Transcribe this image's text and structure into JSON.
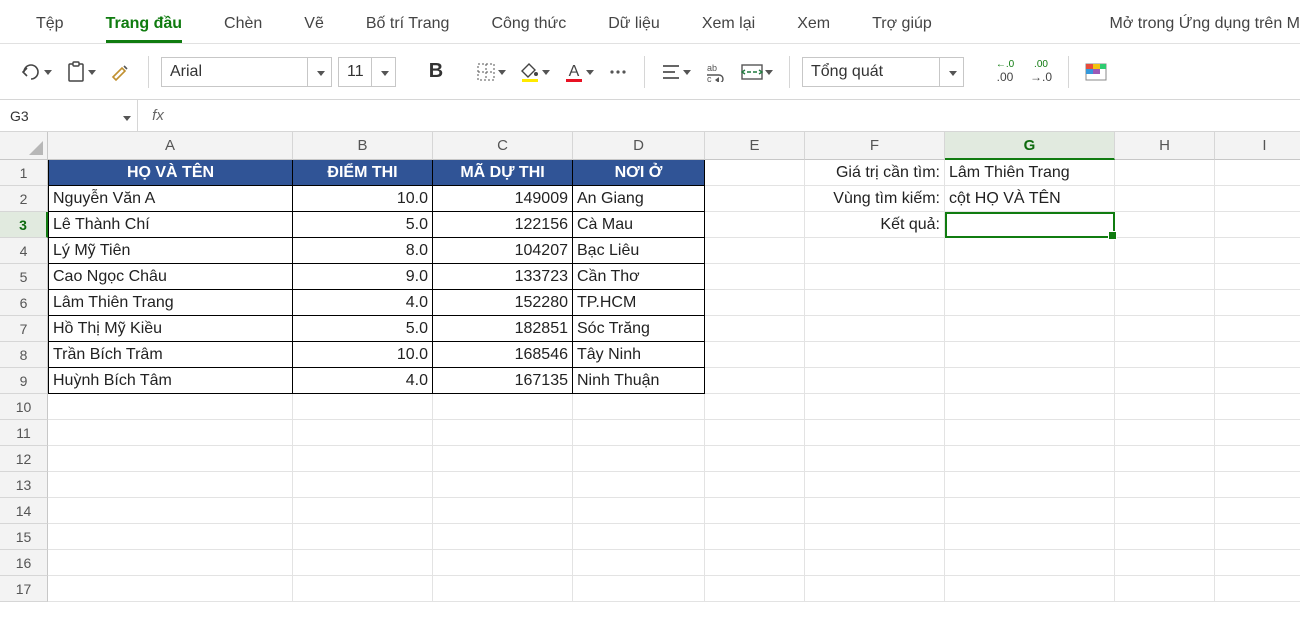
{
  "ribbon": {
    "tabs": [
      "Tệp",
      "Trang đầu",
      "Chèn",
      "Vẽ",
      "Bố trí Trang",
      "Công thức",
      "Dữ liệu",
      "Xem lại",
      "Xem",
      "Trợ giúp"
    ],
    "active_tab_index": 1,
    "open_in_desktop": "Mở trong Ứng dụng trên M"
  },
  "toolbar": {
    "font_name": "Arial",
    "font_size": "11",
    "number_format": "Tổng quát",
    "decrease_decimal_top": "←.0",
    "decrease_decimal_bot": ".00",
    "increase_decimal_top": ".00",
    "increase_decimal_bot": "→.0"
  },
  "formula_bar": {
    "name_box": "G3",
    "fx_label": "fx",
    "formula": ""
  },
  "columns": [
    "A",
    "B",
    "C",
    "D",
    "E",
    "F",
    "G",
    "H",
    "I"
  ],
  "row_count": 17,
  "active_cell": {
    "col": "G",
    "row": 3
  },
  "table": {
    "headers": [
      "HỌ VÀ TÊN",
      "ĐIỂM THI",
      "MÃ DỰ THI",
      "NƠI Ở"
    ],
    "rows": [
      {
        "name": "Nguyễn Văn A",
        "score": "10.0",
        "code": "149009",
        "place": "An Giang"
      },
      {
        "name": "Lê Thành Chí",
        "score": "5.0",
        "code": "122156",
        "place": "Cà Mau"
      },
      {
        "name": "Lý Mỹ Tiên",
        "score": "8.0",
        "code": "104207",
        "place": "Bạc Liêu"
      },
      {
        "name": "Cao Ngọc Châu",
        "score": "9.0",
        "code": "133723",
        "place": "Cần Thơ"
      },
      {
        "name": "Lâm Thiên Trang",
        "score": "4.0",
        "code": "152280",
        "place": "TP.HCM"
      },
      {
        "name": "Hồ Thị Mỹ Kiều",
        "score": "5.0",
        "code": "182851",
        "place": "Sóc Trăng"
      },
      {
        "name": "Trần Bích Trâm",
        "score": "10.0",
        "code": "168546",
        "place": "Tây Ninh"
      },
      {
        "name": "Huỳnh Bích Tâm",
        "score": "4.0",
        "code": "167135",
        "place": "Ninh Thuận"
      }
    ]
  },
  "lookup": {
    "label_value": "Giá trị cần tìm:",
    "value": "Lâm Thiên Trang",
    "label_range": "Vùng tìm kiếm:",
    "range": "cột HỌ VÀ TÊN",
    "label_result": "Kết quả:",
    "result": ""
  }
}
